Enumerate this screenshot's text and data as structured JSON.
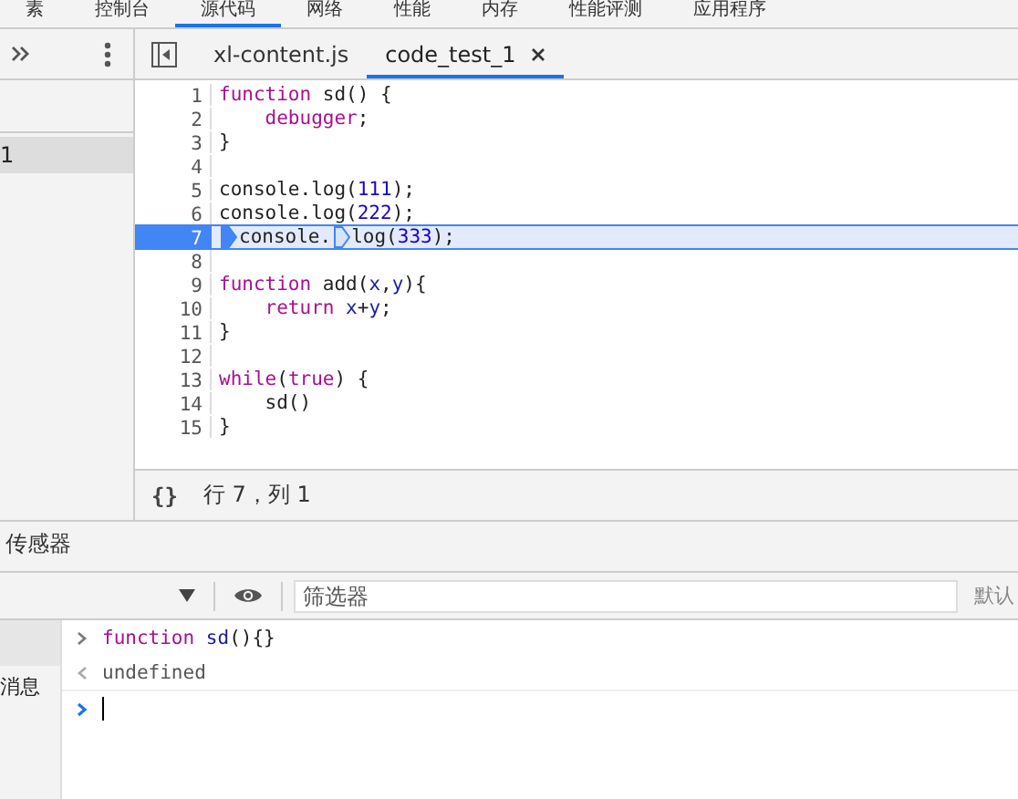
{
  "main_tabs": [
    {
      "label": "素",
      "selected": false
    },
    {
      "label": "控制台",
      "selected": false
    },
    {
      "label": "源代码",
      "selected": true
    },
    {
      "label": "网络",
      "selected": false
    },
    {
      "label": "性能",
      "selected": false
    },
    {
      "label": "内存",
      "selected": false
    },
    {
      "label": "性能评测",
      "selected": false
    },
    {
      "label": "应用程序",
      "selected": false
    }
  ],
  "navigator": {
    "items": [
      {
        "label": "1",
        "selected": true
      }
    ]
  },
  "editor_tabs": [
    {
      "label": "xl-content.js",
      "selected": false,
      "closable": false
    },
    {
      "label": "code_test_1",
      "selected": true,
      "closable": true
    }
  ],
  "code_lines": [
    {
      "number": "1",
      "current": false,
      "tokens": [
        {
          "kind": "keyword",
          "text": "function"
        },
        {
          "kind": "plain",
          "text": " sd() {"
        }
      ]
    },
    {
      "number": "2",
      "current": false,
      "tokens": [
        {
          "kind": "keyword",
          "text": "    debugger"
        },
        {
          "kind": "plain",
          "text": ";"
        }
      ]
    },
    {
      "number": "3",
      "current": false,
      "tokens": [
        {
          "kind": "plain",
          "text": "}"
        }
      ]
    },
    {
      "number": "4",
      "current": false
    },
    {
      "number": "5",
      "current": false,
      "tokens": [
        {
          "kind": "plain",
          "text": "console.log("
        },
        {
          "kind": "number",
          "text": "111"
        },
        {
          "kind": "plain",
          "text": ");"
        }
      ]
    },
    {
      "number": "6",
      "current": false,
      "tokens": [
        {
          "kind": "plain",
          "text": "console.log("
        },
        {
          "kind": "number",
          "text": "222"
        },
        {
          "kind": "plain",
          "text": ");"
        }
      ]
    },
    {
      "number": "7",
      "current": true,
      "tokens": [
        {
          "kind": "marker",
          "active": true
        },
        {
          "kind": "plain",
          "text": "console."
        },
        {
          "kind": "marker",
          "active": false
        },
        {
          "kind": "plain",
          "text": "log("
        },
        {
          "kind": "number",
          "text": "333"
        },
        {
          "kind": "plain",
          "text": ");"
        }
      ]
    },
    {
      "number": "8",
      "current": false
    },
    {
      "number": "9",
      "current": false,
      "tokens": [
        {
          "kind": "keyword",
          "text": "function"
        },
        {
          "kind": "plain",
          "text": " add("
        },
        {
          "kind": "variable",
          "text": "x"
        },
        {
          "kind": "plain",
          "text": ","
        },
        {
          "kind": "variable",
          "text": "y"
        },
        {
          "kind": "plain",
          "text": "){"
        }
      ]
    },
    {
      "number": "10",
      "current": false,
      "tokens": [
        {
          "kind": "keyword",
          "text": "    return "
        },
        {
          "kind": "variable",
          "text": "x"
        },
        {
          "kind": "plain",
          "text": "+"
        },
        {
          "kind": "variable",
          "text": "y"
        },
        {
          "kind": "plain",
          "text": ";"
        }
      ]
    },
    {
      "number": "11",
      "current": false,
      "tokens": [
        {
          "kind": "plain",
          "text": "}"
        }
      ]
    },
    {
      "number": "12",
      "current": false
    },
    {
      "number": "13",
      "current": false,
      "tokens": [
        {
          "kind": "keyword",
          "text": "while"
        },
        {
          "kind": "plain",
          "text": "("
        },
        {
          "kind": "keyword",
          "text": "true"
        },
        {
          "kind": "plain",
          "text": ") {"
        }
      ]
    },
    {
      "number": "14",
      "current": false,
      "tokens": [
        {
          "kind": "plain",
          "text": "    sd()"
        }
      ]
    },
    {
      "number": "15",
      "current": false,
      "tokens": [
        {
          "kind": "plain",
          "text": "}"
        }
      ]
    }
  ],
  "status_bar": {
    "format_button": "{}",
    "position": "行 7，列 1"
  },
  "drawer": {
    "tabs": [
      {
        "label": "传感器",
        "selected": false
      }
    ],
    "filter": {
      "placeholder": "筛选器"
    },
    "levels_label": "默认",
    "sidebar": {
      "items": [
        {
          "label": "消息",
          "selected": false
        }
      ]
    },
    "entries": [
      {
        "kind": "input",
        "tokens": [
          {
            "kind": "keyword",
            "text": "function "
          },
          {
            "kind": "name",
            "text": "sd"
          },
          {
            "kind": "plain",
            "text": "(){}"
          }
        ]
      },
      {
        "kind": "result",
        "tokens": [
          {
            "kind": "plain",
            "text": "undefined"
          }
        ]
      },
      {
        "kind": "prompt"
      }
    ]
  }
}
